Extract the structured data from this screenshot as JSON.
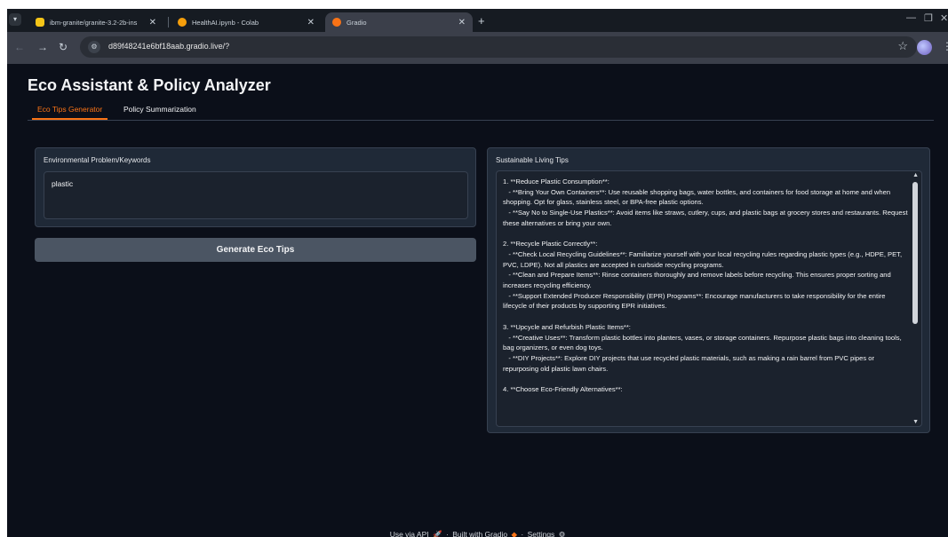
{
  "browser": {
    "tabs": [
      {
        "title": "ibm-granite/granite-3.2-2b-ins",
        "favicon": "hugging-face-icon"
      },
      {
        "title": "HealthAI.ipynb - Colab",
        "favicon": "colab-icon"
      },
      {
        "title": "Gradio",
        "favicon": "gradio-icon"
      }
    ],
    "url": "d89f48241e6bf18aab.gradio.live/?"
  },
  "app": {
    "title": "Eco Assistant & Policy Analyzer",
    "tabs": [
      "Eco Tips Generator",
      "Policy Summarization"
    ],
    "active_tab": "Eco Tips Generator",
    "input_label": "Environmental Problem/Keywords",
    "input_value": "plastic",
    "generate_label": "Generate Eco Tips",
    "output_label": "Sustainable Living Tips",
    "output_text": "1. **Reduce Plastic Consumption**:\n   - **Bring Your Own Containers**: Use reusable shopping bags, water bottles, and containers for food storage at home and when shopping. Opt for glass, stainless steel, or BPA-free plastic options.\n   - **Say No to Single-Use Plastics**: Avoid items like straws, cutlery, cups, and plastic bags at grocery stores and restaurants. Request these alternatives or bring your own.\n\n2. **Recycle Plastic Correctly**:\n   - **Check Local Recycling Guidelines**: Familiarize yourself with your local recycling rules regarding plastic types (e.g., HDPE, PET, PVC, LDPE). Not all plastics are accepted in curbside recycling programs.\n   - **Clean and Prepare Items**: Rinse containers thoroughly and remove labels before recycling. This ensures proper sorting and increases recycling efficiency.\n   - **Support Extended Producer Responsibility (EPR) Programs**: Encourage manufacturers to take responsibility for the entire lifecycle of their products by supporting EPR initiatives.\n\n3. **Upcycle and Refurbish Plastic Items**:\n   - **Creative Uses**: Transform plastic bottles into planters, vases, or storage containers. Repurpose plastic bags into cleaning tools, bag organizers, or even dog toys.\n   - **DIY Projects**: Explore DIY projects that use recycled plastic materials, such as making a rain barrel from PVC pipes or repurposing old plastic lawn chairs.\n\n4. **Choose Eco-Friendly Alternatives**:"
  },
  "footer": {
    "api": "Use via API",
    "built": "Built with Gradio",
    "settings": "Settings",
    "sep": "·"
  },
  "colors": {
    "accent": "#f97316",
    "background": "#0b0f19",
    "panel": "#1f2937",
    "button": "#4b5563"
  }
}
